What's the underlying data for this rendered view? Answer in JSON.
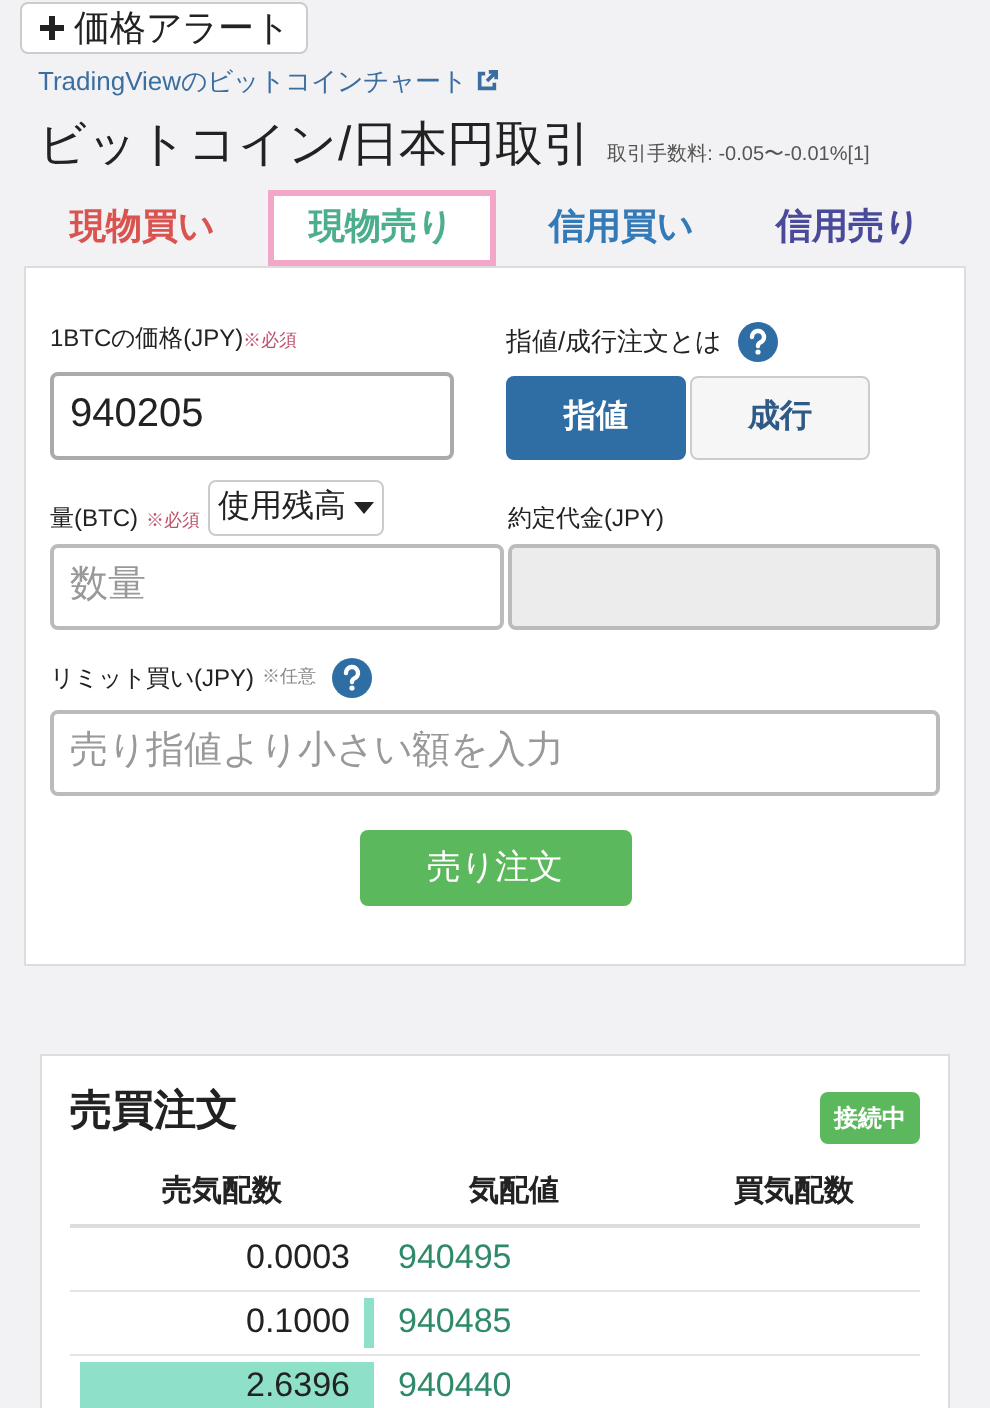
{
  "alert_button": {
    "label": "価格アラート"
  },
  "chart_link": {
    "label": "TradingViewのビットコインチャート"
  },
  "title": {
    "text": "ビットコイン/日本円取引",
    "fee": "取引手数料: -0.05〜-0.01%[1]"
  },
  "tabs": [
    {
      "label": "現物買い",
      "selected": false,
      "color": "#d9534f"
    },
    {
      "label": "現物売り",
      "selected": true,
      "color": "#4cae8c"
    },
    {
      "label": "信用買い",
      "selected": false,
      "color": "#337ab7"
    },
    {
      "label": "信用売り",
      "selected": false,
      "color": "#4a4a9a"
    }
  ],
  "form": {
    "price": {
      "label": "1BTCの価格(JPY)",
      "required": "※必須",
      "value": "940205"
    },
    "order_type": {
      "label": "指値/成行注文とは",
      "options": [
        {
          "label": "指値",
          "selected": true
        },
        {
          "label": "成行",
          "selected": false
        }
      ]
    },
    "amount": {
      "label": "量(BTC)",
      "required": "※必須",
      "dropdown": "使用残高",
      "placeholder": "数量"
    },
    "total": {
      "label": "約定代金(JPY)",
      "disabled": true
    },
    "limit": {
      "label": "リミット買い(JPY)",
      "optional": "※任意",
      "placeholder": "売り指値より小さい額を入力"
    },
    "submit": "売り注文"
  },
  "order_book": {
    "title": "売買注文",
    "status": "接続中",
    "columns": [
      "売気配数",
      "気配値",
      "買気配数"
    ],
    "rows": [
      {
        "ask": "0.0003",
        "price": "940495"
      },
      {
        "ask": "0.1000",
        "price": "940485"
      },
      {
        "ask": "2.6396",
        "price": "940440"
      }
    ]
  }
}
